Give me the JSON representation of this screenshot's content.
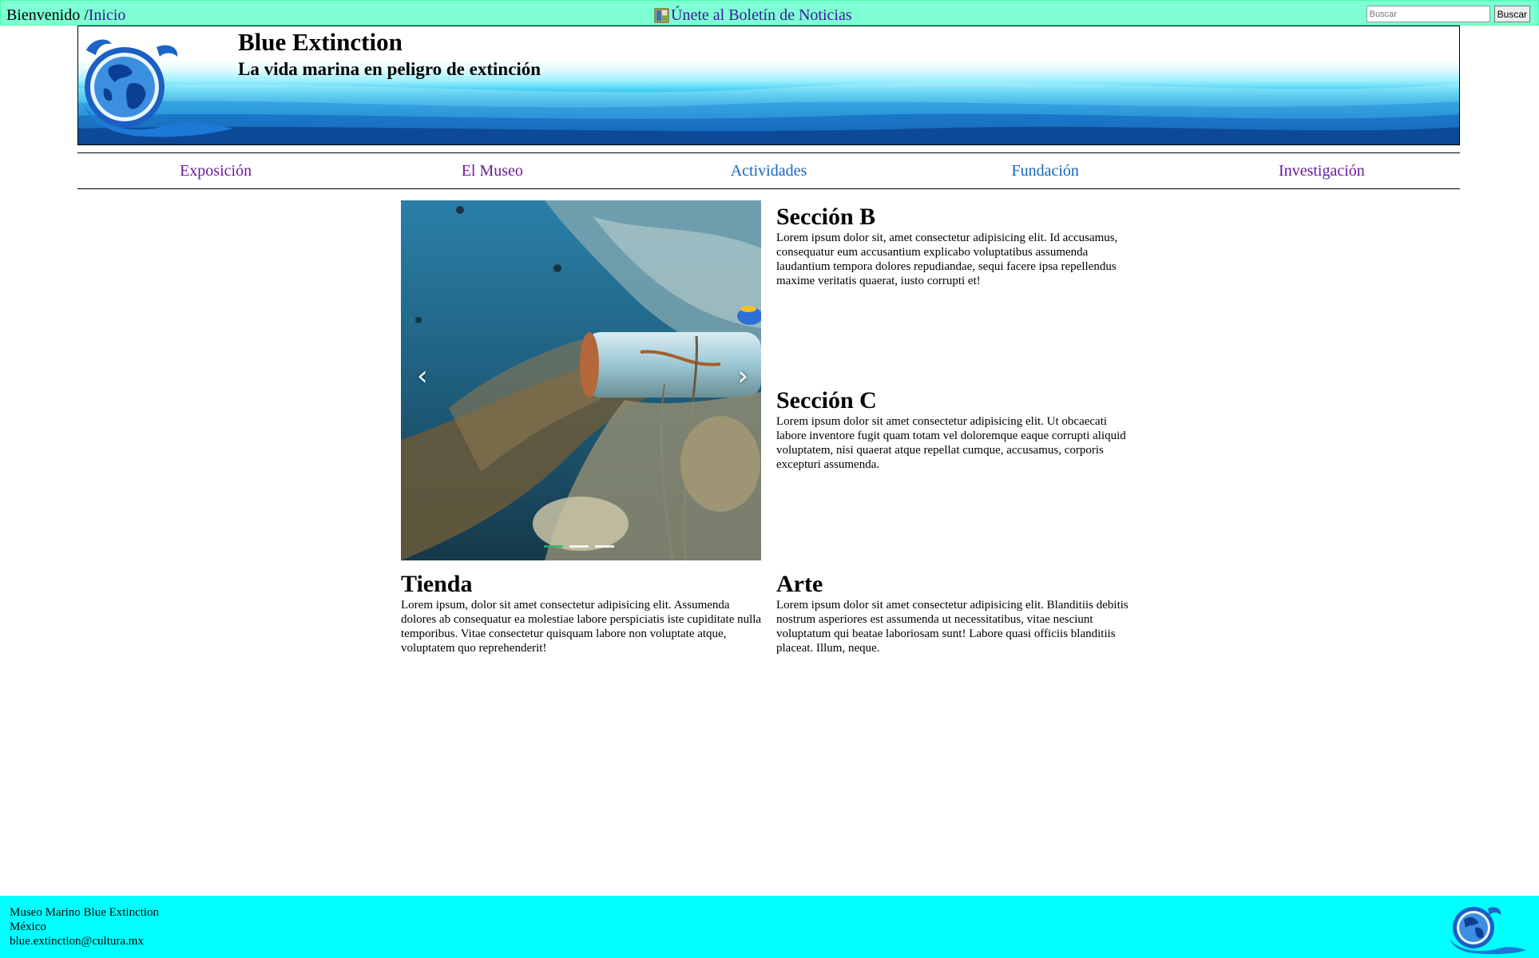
{
  "topbar": {
    "greeting": "Bienvenido /",
    "home_link": "Inicio",
    "newsletter": "Únete al Boletín de Noticias",
    "search_placeholder": "Buscar",
    "search_button": "Buscar"
  },
  "header": {
    "title": "Blue Extinction",
    "subtitle": "La vida marina en peligro de extinción"
  },
  "nav": {
    "items": [
      {
        "label": "Exposición",
        "state": "visited"
      },
      {
        "label": "El Museo",
        "state": "visited"
      },
      {
        "label": "Actividades",
        "state": "link"
      },
      {
        "label": "Fundación",
        "state": "link"
      },
      {
        "label": "Investigación",
        "state": "visited"
      }
    ]
  },
  "carousel": {
    "prev_icon": "chevron-left-icon",
    "next_icon": "chevron-right-icon",
    "slides": 3,
    "active_slide": 1
  },
  "sections": {
    "b": {
      "title": "Sección B",
      "text": "Lorem ipsum dolor sit, amet consectetur adipisicing elit. Id accusamus, consequatur eum accusantium explicabo voluptatibus assumenda laudantium tempora dolores repudiandae, sequi facere ipsa repellendus maxime veritatis quaerat, iusto corrupti et!"
    },
    "c": {
      "title": "Sección C",
      "text": "Lorem ipsum dolor sit amet consectetur adipisicing elit. Ut obcaecati labore inventore fugit quam totam vel doloremque eaque corrupti aliquid voluptatem, nisi quaerat atque repellat cumque, accusamus, corporis excepturi assumenda."
    },
    "tienda": {
      "title": "Tienda",
      "text": "Lorem ipsum, dolor sit amet consectetur adipisicing elit. Assumenda dolores ab consequatur ea molestiae labore perspiciatis iste cupiditate nulla temporibus. Vitae consectetur quisquam labore non voluptate atque, voluptatem quo reprehenderit!"
    },
    "arte": {
      "title": "Arte",
      "text": "Lorem ipsum dolor sit amet consectetur adipisicing elit. Blanditiis debitis nostrum asperiores est assumenda ut necessitatibus, vitae nesciunt voluptatum qui beatae laboriosam sunt! Labore quasi officiis blanditiis placeat. Illum, neque."
    }
  },
  "footer": {
    "line1": "Museo Marino Blue Extinction",
    "line2": "México",
    "line3": "blue.extinction@cultura.mx"
  },
  "colors": {
    "topbar_bg": "#7fffd4",
    "footer_bg": "#00ffff",
    "visited_link": "#6a1b9a",
    "link": "#1565c0"
  }
}
